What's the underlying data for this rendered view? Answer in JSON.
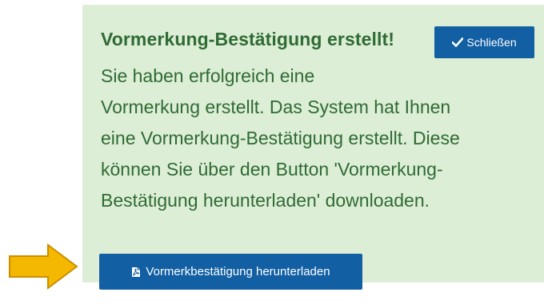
{
  "notice": {
    "title": "Vormerkung-Bestätigung erstellt!",
    "close_label": "Schließen",
    "message_lines": [
      "Sie haben erfolgreich eine",
      "Vormerkung erstellt. Das System hat Ihnen",
      "eine Vormerkung-Bestätigung erstellt. Diese",
      "können Sie über den Button 'Vormerkung-",
      "Bestätigung herunterladen' downloaden."
    ],
    "download_label": "Vormerkbestätigung herunterladen"
  },
  "icons": {
    "close": "checkmark-icon",
    "download": "pdf-file-icon",
    "pointer": "arrow-right-icon"
  },
  "colors": {
    "panel_background": "#ddeed6",
    "text": "#2f6b34",
    "button": "#125fa3",
    "arrow_fill": "#f5b800",
    "arrow_stroke": "#c98f00"
  }
}
